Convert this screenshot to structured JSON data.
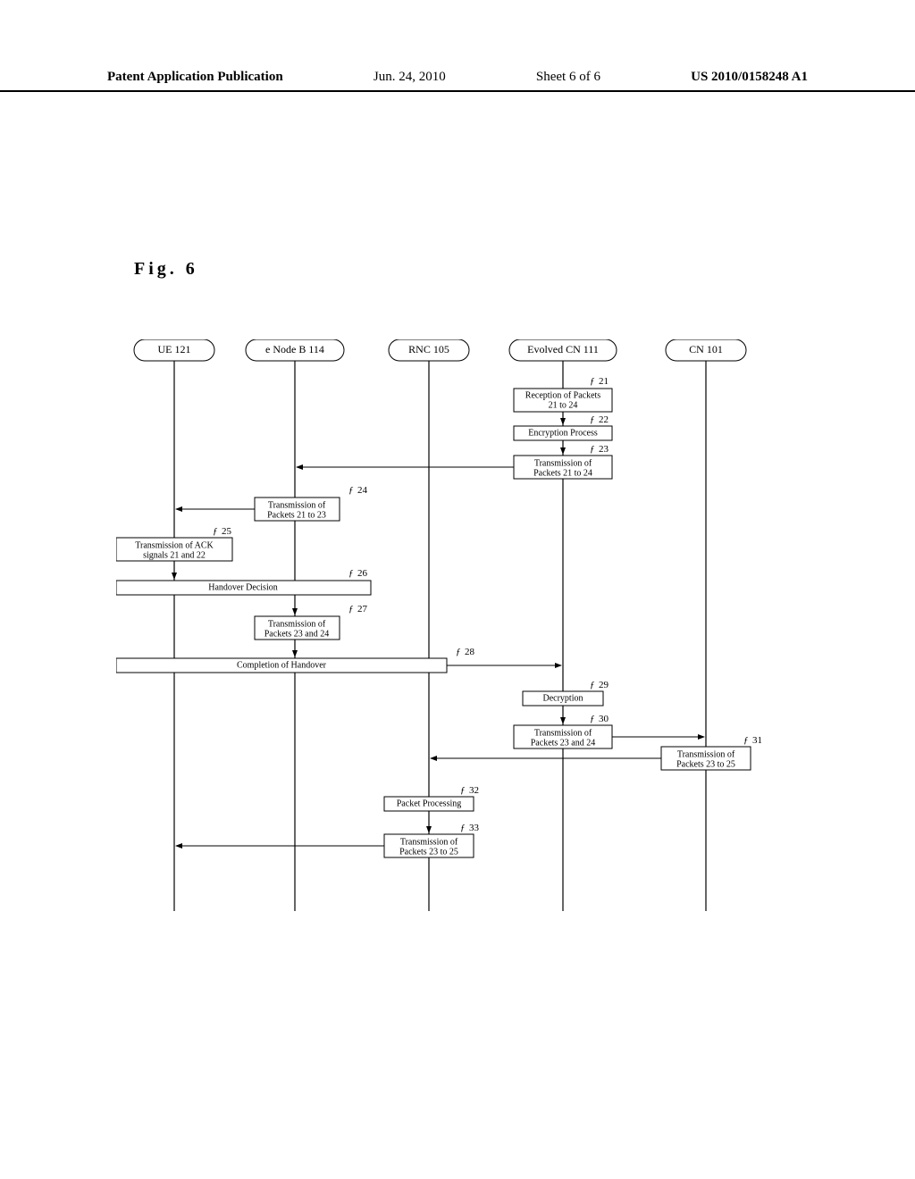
{
  "header": {
    "publication": "Patent Application Publication",
    "date": "Jun. 24, 2010",
    "sheet": "Sheet 6 of 6",
    "pubnum": "US 2010/0158248 A1"
  },
  "figure": {
    "title": "Fig. 6"
  },
  "lanes": {
    "ue": "UE 121",
    "enodeb": "e Node B 114",
    "rnc": "RNC 105",
    "evolved_cn": "Evolved CN 111",
    "cn": "CN 101"
  },
  "steps": {
    "s21": {
      "ref": "21",
      "line1": "Reception of Packets",
      "line2": "21 to 24"
    },
    "s22": {
      "ref": "22",
      "label": "Encryption Process"
    },
    "s23": {
      "ref": "23",
      "line1": "Transmission of",
      "line2": "Packets 21 to 24"
    },
    "s24": {
      "ref": "24",
      "line1": "Transmission of",
      "line2": "Packets 21 to 23"
    },
    "s25": {
      "ref": "25",
      "line1": "Transmission of ACK",
      "line2": "signals 21 and 22"
    },
    "s26": {
      "ref": "26",
      "label": "Handover Decision"
    },
    "s27": {
      "ref": "27",
      "line1": "Transmission of",
      "line2": "Packets 23 and 24"
    },
    "s28": {
      "ref": "28",
      "label": "Completion of Handover"
    },
    "s29": {
      "ref": "29",
      "label": "Decryption"
    },
    "s30": {
      "ref": "30",
      "line1": "Transmission of",
      "line2": "Packets 23 and 24"
    },
    "s31": {
      "ref": "31",
      "line1": "Transmission of",
      "line2": "Packets 23 to 25"
    },
    "s32": {
      "ref": "32",
      "label": "Packet Processing"
    },
    "s33": {
      "ref": "33",
      "line1": "Transmission of",
      "line2": "Packets 23 to 25"
    }
  }
}
